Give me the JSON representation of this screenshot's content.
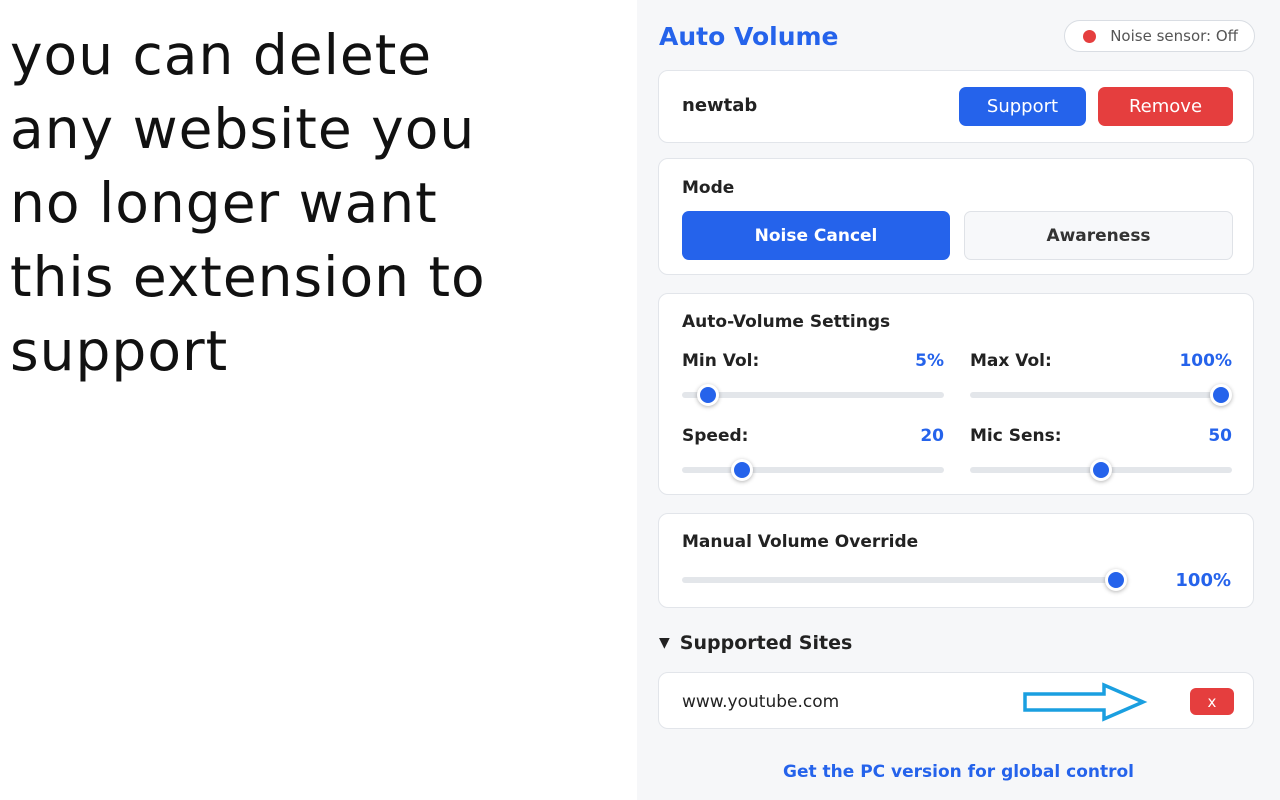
{
  "caption": {
    "lines": [
      "you can delete",
      "any website you",
      "no longer want",
      "this extension to",
      "support"
    ]
  },
  "header": {
    "title": "Auto Volume",
    "noise_sensor": "Noise sensor: Off"
  },
  "site_card": {
    "site": "newtab",
    "support_label": "Support",
    "remove_label": "Remove"
  },
  "mode": {
    "label": "Mode",
    "options": [
      "Noise Cancel",
      "Awareness"
    ],
    "selected": "Noise Cancel"
  },
  "settings": {
    "label": "Auto-Volume Settings",
    "sliders": [
      {
        "label": "Min Vol:",
        "value": "5%",
        "position": 0.1
      },
      {
        "label": "Max Vol:",
        "value": "100%",
        "position": 1.0
      },
      {
        "label": "Speed:",
        "value": "20",
        "position": 0.23
      },
      {
        "label": "Mic Sens:",
        "value": "50",
        "position": 0.5
      }
    ]
  },
  "manual": {
    "label": "Manual Volume Override",
    "value": "100%",
    "position": 1.0
  },
  "supported_sites": {
    "toggle_label": "Supported Sites",
    "sites": [
      {
        "url": "www.youtube.com",
        "delete_label": "x"
      }
    ]
  },
  "footer": {
    "link": "Get the PC version for global control"
  },
  "colors": {
    "accent": "#2563eb",
    "danger": "#e53e3e",
    "arrow": "#1a9fe0"
  }
}
